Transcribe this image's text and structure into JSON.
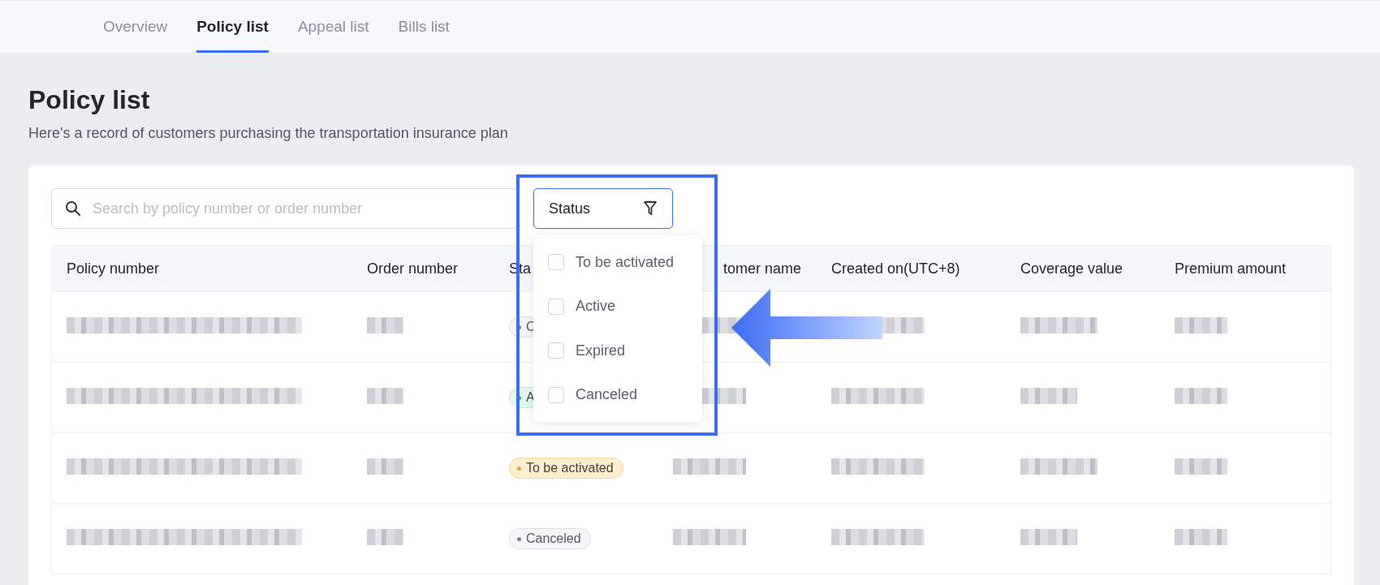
{
  "tabs": [
    {
      "label": "Overview",
      "selected": false
    },
    {
      "label": "Policy list",
      "selected": true
    },
    {
      "label": "Appeal list",
      "selected": false
    },
    {
      "label": "Bills list",
      "selected": false
    }
  ],
  "page": {
    "title": "Policy list",
    "subtitle": "Here's a record of customers purchasing the transportation insurance plan"
  },
  "search": {
    "placeholder": "Search by policy number or order number"
  },
  "status_filter": {
    "label": "Status",
    "options": [
      {
        "label": "To be activated",
        "checked": false
      },
      {
        "label": "Active",
        "checked": false
      },
      {
        "label": "Expired",
        "checked": false
      },
      {
        "label": "Canceled",
        "checked": false
      }
    ]
  },
  "table": {
    "columns": [
      "Policy number",
      "Order number",
      "Sta",
      "tomer name",
      "Created on(UTC+8)",
      "Coverage value",
      "Premium amount"
    ],
    "rows": [
      {
        "status": {
          "label": "C",
          "kind": "canceled"
        }
      },
      {
        "status": {
          "label": "A",
          "kind": "active"
        }
      },
      {
        "status": {
          "label": "To be activated",
          "kind": "pending"
        }
      },
      {
        "status": {
          "label": "Canceled",
          "kind": "canceled"
        }
      }
    ]
  }
}
